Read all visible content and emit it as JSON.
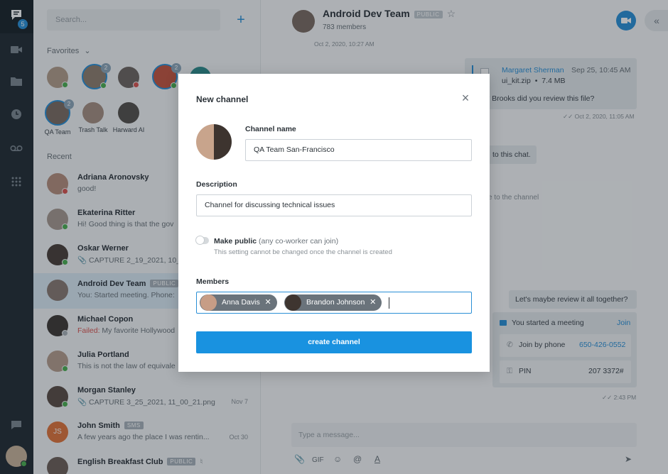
{
  "rail": {
    "unread_count": "5"
  },
  "sidebar": {
    "search_placeholder": "Search...",
    "favorites_label": "Favorites",
    "favorites": [
      {
        "label": "",
        "count": ""
      },
      {
        "label": "",
        "count": "2"
      },
      {
        "label": "",
        "count": ""
      },
      {
        "label": "",
        "count": "2"
      },
      {
        "label": "QA Team",
        "count": "2"
      },
      {
        "label": "Trash Talk",
        "count": ""
      },
      {
        "label": "Harward AI",
        "count": ""
      }
    ],
    "recent_label": "Recent",
    "recent": [
      {
        "name": "Adriana Aronovsky",
        "preview": "good!",
        "date": ""
      },
      {
        "name": "Ekaterina Ritter",
        "preview": "Hi! Good thing is that the gov",
        "date": ""
      },
      {
        "name": "Oskar Werner",
        "preview": "CAPTURE 2_19_2021, 10_1",
        "date": ""
      },
      {
        "name": "Android Dev Team",
        "tag": "PUBLIC",
        "preview": "You: Started meeting. Phone:",
        "date": ""
      },
      {
        "name": "Michael Copon",
        "failed": "Failed:",
        "preview": " My favorite Hollywood",
        "date": ""
      },
      {
        "name": "Julia Portland",
        "preview": "This is not the law of equivale",
        "date": ""
      },
      {
        "name": "Morgan Stanley",
        "preview": "CAPTURE 3_25_2021, 11_00_21.png",
        "date": "Nov 7"
      },
      {
        "name": "John Smith",
        "tag": "SMS",
        "initials": "JS",
        "preview": "A few years ago the place I was rentin...",
        "date": "Oct 30"
      },
      {
        "name": "English Breakfast Club",
        "tag": "PUBLIC",
        "preview": "",
        "date": ""
      }
    ]
  },
  "chat": {
    "title": "Android Dev Team",
    "title_tag": "PUBLIC",
    "members": "783 members",
    "top_time": "Oct 2, 2020, 10:27 AM",
    "file_sender": "Margaret Sherman",
    "file_time": "Sep 25, 10:45 AM",
    "file_name": "ui_kit.zip",
    "file_size": "7.4 MB",
    "msg1": "y Brooks did you review this file?",
    "msg1_time": "Oct 2, 2020, 11:05 AM",
    "msg2": "to this chat.",
    "msg3": "e to the channel",
    "msg4": "Let's maybe review it all together?",
    "meeting_text": "You started a meeting",
    "meeting_join": "Join",
    "phone_label": "Join by phone",
    "phone_value": "650-426-0552",
    "pin_label": "PIN",
    "pin_value": "207 3372#",
    "meeting_time": "2:43 PM",
    "composer_placeholder": "Type a message...",
    "gif_label": "GIF"
  },
  "modal": {
    "title": "New channel",
    "name_label": "Channel name",
    "name_value": "QA Team San-Francisco",
    "desc_label": "Description",
    "desc_value": "Channel for discussing technical issues",
    "public_label": "Make public",
    "public_note": "(any co-worker can join)",
    "public_hint": "This setting cannot be changed once the channel is created",
    "members_label": "Members",
    "members": [
      "Anna Davis",
      "Brandon Johnson"
    ],
    "create_label": "create channel"
  }
}
